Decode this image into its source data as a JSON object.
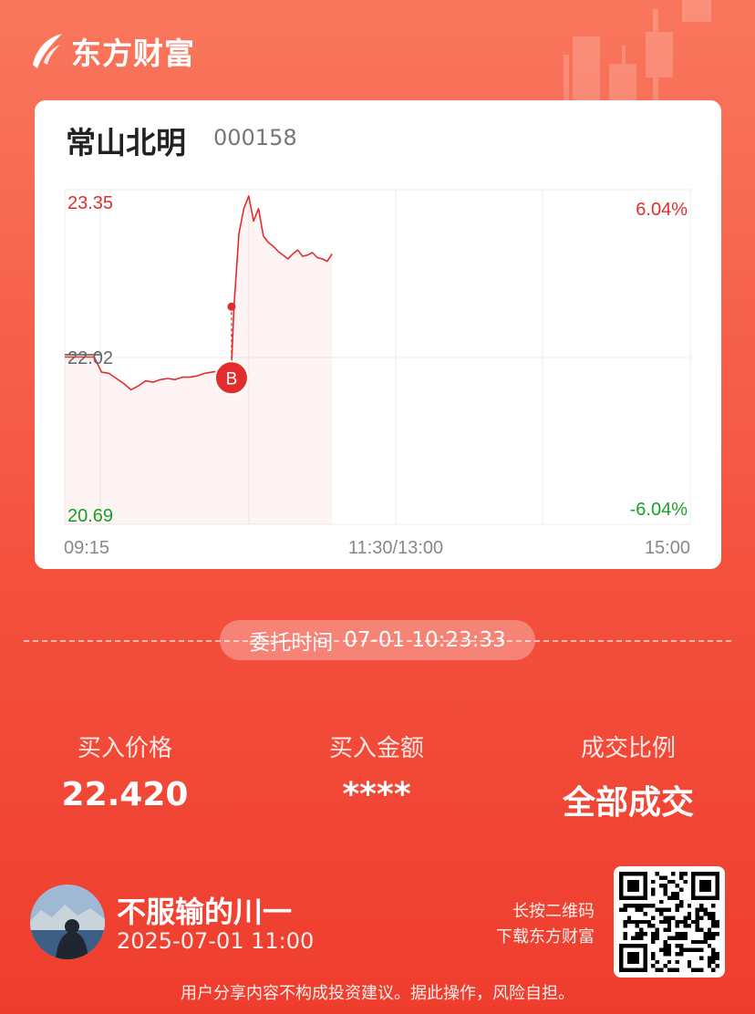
{
  "brand": {
    "name": "东方财富"
  },
  "stock": {
    "name": "常山北明",
    "code": "000158"
  },
  "chart_data": {
    "type": "line",
    "y_left_ticks": [
      "23.35",
      "22.02",
      "20.69"
    ],
    "y_right_ticks": [
      "6.04%",
      "-6.04%"
    ],
    "x_ticks": [
      "09:15",
      "11:30/13:00",
      "15:00"
    ],
    "ylim": [
      20.69,
      23.35
    ],
    "prev_close": 22.02,
    "x": [
      "09:15",
      "09:18",
      "09:21",
      "09:24",
      "09:27",
      "09:30",
      "09:33",
      "09:36",
      "09:39",
      "09:42",
      "09:45",
      "09:48",
      "09:51",
      "09:54",
      "09:57",
      "10:00",
      "10:03",
      "10:06",
      "10:09",
      "10:12",
      "10:15",
      "10:18",
      "10:21",
      "10:23",
      "10:24",
      "10:26",
      "10:28",
      "10:30",
      "10:32",
      "10:34",
      "10:36",
      "10:38",
      "10:40",
      "10:42",
      "10:44",
      "10:46",
      "10:48",
      "10:50",
      "10:52",
      "10:54",
      "10:56",
      "10:58",
      "11:00",
      "11:02",
      "11:04"
    ],
    "series": [
      {
        "values": [
          22.02,
          22.02,
          22.02,
          22.02,
          22.02,
          21.9,
          21.89,
          21.85,
          21.81,
          21.76,
          21.79,
          21.83,
          21.82,
          21.84,
          21.85,
          21.84,
          21.86,
          21.86,
          21.87,
          21.89,
          21.9,
          21.91,
          21.94,
          21.95,
          22.42,
          23.0,
          23.2,
          23.3,
          23.1,
          23.2,
          22.98,
          22.93,
          22.9,
          22.86,
          22.83,
          22.8,
          22.84,
          22.87,
          22.82,
          22.83,
          22.85,
          22.81,
          22.8,
          22.78,
          22.84
        ]
      }
    ],
    "markers": [
      {
        "label": "B",
        "x": "10:23",
        "price": 22.42
      }
    ],
    "grid": true
  },
  "order": {
    "time_label": "委托时间",
    "time_value": "07-01 10:23:33"
  },
  "stats": [
    {
      "label": "买入价格",
      "value": "22.420"
    },
    {
      "label": "买入金额",
      "value": "****"
    },
    {
      "label": "成交比例",
      "value": "全部成交"
    }
  ],
  "user": {
    "name": "不服输的川一",
    "time": "2025-07-01 11:00"
  },
  "qr_hint": {
    "line1": "长按二维码",
    "line2": "下载东方财富"
  },
  "disclaimer": "用户分享内容不构成投资建议。据此操作，风险自担。",
  "colors": {
    "up": "#e32d2d",
    "down": "#19a028",
    "accent": "#f4523f"
  },
  "icons": {
    "brand_logo": "feather-logo-icon",
    "marker": "buy-marker-icon",
    "qr": "qr-code-icon"
  }
}
